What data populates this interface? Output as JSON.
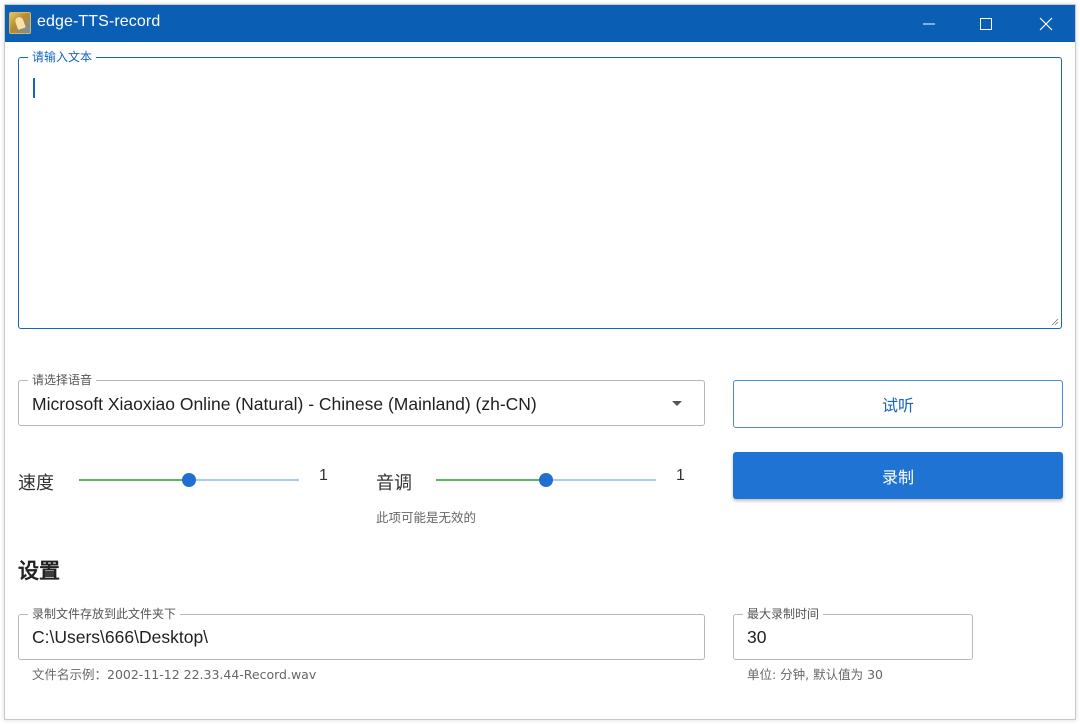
{
  "window": {
    "title": "edge-TTS-record"
  },
  "text_input": {
    "label": "请输入文本",
    "value": ""
  },
  "voice_select": {
    "label": "请选择语音",
    "selected": "Microsoft Xiaoxiao Online (Natural) - Chinese (Mainland) (zh-CN)"
  },
  "buttons": {
    "preview": "试听",
    "record": "录制"
  },
  "speed": {
    "label": "速度",
    "value": "1",
    "level": 0.5
  },
  "pitch": {
    "label": "音调",
    "value": "1",
    "level": 0.5,
    "hint": "此项可能是无效的"
  },
  "settings": {
    "title": "设置",
    "folder": {
      "label": "录制文件存放到此文件夹下",
      "value": "C:\\Users\\666\\Desktop\\",
      "hint": "文件名示例：2002-11-12 22.33.44-Record.wav"
    },
    "max_time": {
      "label": "最大录制时间",
      "value": "30",
      "hint": "单位: 分钟, 默认值为 30"
    }
  },
  "icons": {
    "app": "app-logo-icon",
    "minimize": "minimize-icon",
    "maximize": "maximize-icon",
    "close": "close-icon",
    "dropdown": "chevron-down-icon"
  },
  "colors": {
    "titlebar": "#0a5fb4",
    "accent": "#1f73d2",
    "slider_fill": "#5cb55f",
    "slider_rest": "#a9cbee"
  }
}
